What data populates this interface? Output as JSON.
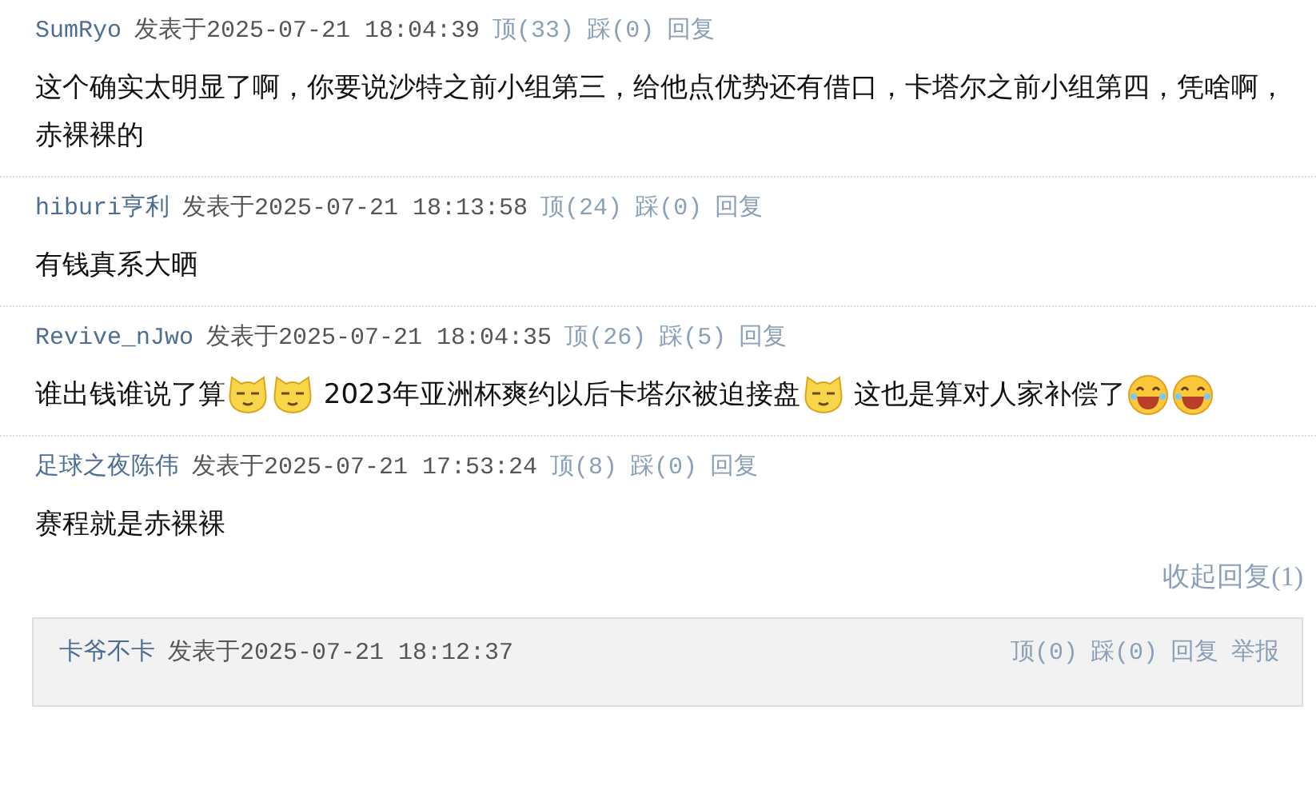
{
  "comments": [
    {
      "author": "SumRyo",
      "posted": "发表于2025-07-21 18:04:39",
      "up": "顶(33)",
      "down": "踩(0)",
      "reply": "回复",
      "body": [
        {
          "kind": "text",
          "text": "这个确实太明显了啊，你要说沙特之前小组第三，给他点优势还有借口，卡塔尔之前小组第四，凭啥啊，赤裸裸的"
        }
      ]
    },
    {
      "author": "hiburi亨利",
      "posted": "发表于2025-07-21 18:13:58",
      "up": "顶(24)",
      "down": "踩(0)",
      "reply": "回复",
      "body": [
        {
          "kind": "text",
          "text": "有钱真系大晒"
        }
      ]
    },
    {
      "author": "Revive_nJwo",
      "posted": "发表于2025-07-21 18:04:35",
      "up": "顶(26)",
      "down": "踩(5)",
      "reply": "回复",
      "body": [
        {
          "kind": "text",
          "text": "谁出钱谁说了算"
        },
        {
          "kind": "smug"
        },
        {
          "kind": "smug"
        },
        {
          "kind": "text",
          "text": " 2023年亚洲杯爽约以后卡塔尔被迫接盘"
        },
        {
          "kind": "smug"
        },
        {
          "kind": "text",
          "text": " 这也是算对人家补偿了"
        },
        {
          "kind": "laugh"
        },
        {
          "kind": "laugh"
        }
      ]
    },
    {
      "author": "足球之夜陈伟",
      "posted": "发表于2025-07-21 17:53:24",
      "up": "顶(8)",
      "down": "踩(0)",
      "reply": "回复",
      "body": [
        {
          "kind": "text",
          "text": "赛程就是赤裸裸"
        }
      ],
      "collapse": "收起回复(1)",
      "replies": [
        {
          "author": "卡爷不卡",
          "posted": "发表于2025-07-21 18:12:37",
          "up": "顶(0)",
          "down": "踩(0)",
          "reply": "回复",
          "report": "举报"
        }
      ]
    }
  ]
}
